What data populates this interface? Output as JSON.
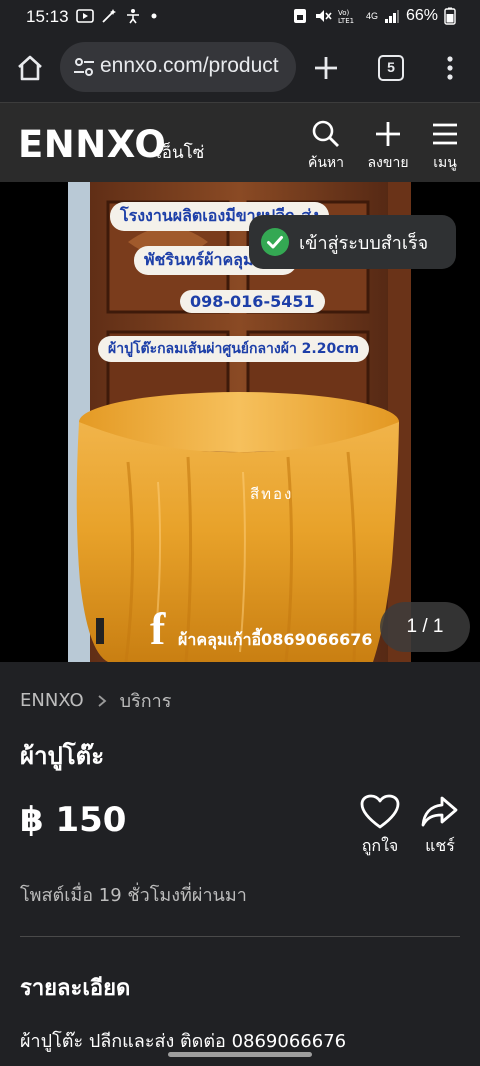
{
  "status_bar": {
    "time": "15:13",
    "battery": "66%",
    "network": "4G"
  },
  "browser": {
    "url": "ennxo.com/product",
    "tab_count": "5"
  },
  "header": {
    "logo": "ENNXO",
    "logo_thai": "เอ็นโซ่",
    "search_label": "ค้นหา",
    "post_label": "ลงขาย",
    "menu_label": "เมนู"
  },
  "gallery": {
    "sign_lines": [
      "โรงงานผลิตเองมีขายปลีก-ส่ง",
      "พัชรินทร์ผ้าคลุมเก้าอี้",
      "098-016-5451",
      "ผ้าปูโต๊ะกลมเส้นผ่าศูนย์กลางผ้า 2.20cm"
    ],
    "caption": "สีทอง",
    "fb_text": "ผ้าคลุมเก้าอี้0869066676",
    "counter": "1 / 1",
    "toast": "เข้าสู่ระบบสำเร็จ"
  },
  "breadcrumb": {
    "root": "ENNXO",
    "category": "บริการ"
  },
  "product": {
    "title": "ผ้าปูโต๊ะ",
    "price": "฿ 150",
    "like_label": "ถูกใจ",
    "share_label": "แชร์",
    "posted": "โพสต์เมื่อ 19 ชั่วโมงที่ผ่านมา",
    "details_heading": "รายละเอียด",
    "details_text": "ผ้าปูโต๊ะ ปลีกและส่ง ติดต่อ 0869066676"
  },
  "colors": {
    "background": "#202124",
    "header": "#2b2b2b",
    "toast_check": "#34a853",
    "tablecloth": "#e8a22a"
  }
}
